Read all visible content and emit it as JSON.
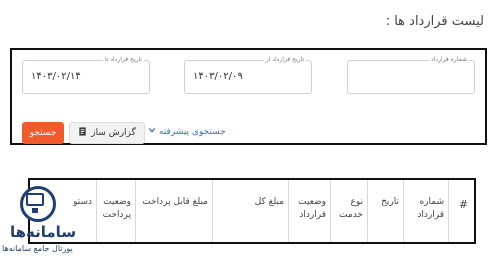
{
  "page": {
    "title": "لیست قرارداد ها :"
  },
  "filters": {
    "contract_number": {
      "label": "شماره قرارداد",
      "value": ""
    },
    "date_from": {
      "label": "تاریخ قرارداد از",
      "value": "۱۴۰۳/۰۲/۰۹"
    },
    "date_to": {
      "label": "تاریخ قرارداد تا",
      "value": "۱۴۰۳/۰۲/۱۴"
    }
  },
  "actions": {
    "search_label": "جستجو",
    "report_label": "گزارش ساز",
    "advanced_label": "جستجوی پیشرفته"
  },
  "table": {
    "columns": [
      "#",
      "شماره قرارداد",
      "تاریخ",
      "نوع خدمت",
      "وضعیت قرارداد",
      "مبلغ کل",
      "مبلغ قابل پرداخت",
      "وضعیت پرداخت",
      "دستو"
    ]
  },
  "watermark": {
    "name": "سامانه‌ها",
    "subtitle": "پورتال جامع سامانه‌ها"
  },
  "colors": {
    "accent": "#f15a2b",
    "link": "#3b6fb6",
    "brand": "#1f3f73"
  }
}
